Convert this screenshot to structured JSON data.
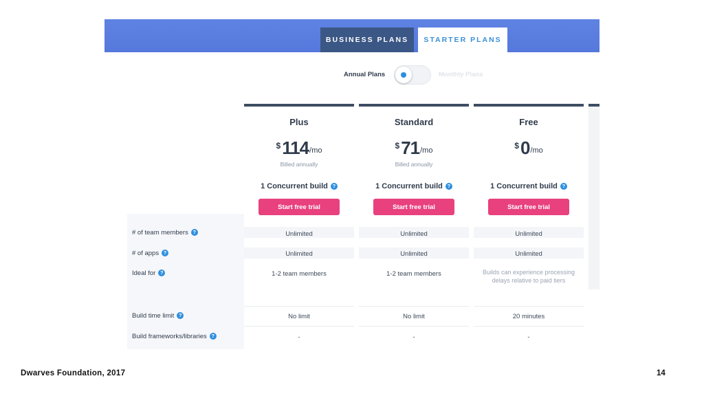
{
  "tabs": {
    "business": "BUSINESS PLANS",
    "starter": "STARTER PLANS"
  },
  "billing_toggle": {
    "annual_label": "Annual Plans",
    "monthly_label": "Monthly Plans",
    "selected": "annual"
  },
  "row_labels": [
    "# of team members",
    "# of apps",
    "Ideal for",
    "Build time limit",
    "Build frameworks/libraries"
  ],
  "help_icon_glyph": "?",
  "plans": [
    {
      "name": "Plus",
      "currency": "$",
      "price": "114",
      "unit": "/mo",
      "billed": "Billed annually",
      "concurrent": "1 Concurrent build",
      "cta": "Start free trial",
      "cells": [
        "Unlimited",
        "Unlimited",
        "1-2 team members",
        "No limit",
        "-"
      ]
    },
    {
      "name": "Standard",
      "currency": "$",
      "price": "71",
      "unit": "/mo",
      "billed": "Billed annually",
      "concurrent": "1 Concurrent build",
      "cta": "Start free trial",
      "cells": [
        "Unlimited",
        "Unlimited",
        "1-2 team members",
        "No limit",
        "-"
      ]
    },
    {
      "name": "Free",
      "currency": "$",
      "price": "0",
      "unit": "/mo",
      "billed": "",
      "concurrent": "1 Concurrent build",
      "cta": "Start free trial",
      "cells": [
        "Unlimited",
        "Unlimited",
        "Builds can experience processing delays relative to paid tiers",
        "20 minutes",
        "-"
      ]
    }
  ],
  "footer": {
    "left": "Dwarves Foundation, 2017",
    "page_number": "14"
  },
  "colors": {
    "header_blue": "#5b7fe0",
    "business_tab": "#3b5785",
    "accent_blue": "#2f8fde",
    "cta_pink": "#e8417e",
    "column_top": "#3d4d63"
  }
}
